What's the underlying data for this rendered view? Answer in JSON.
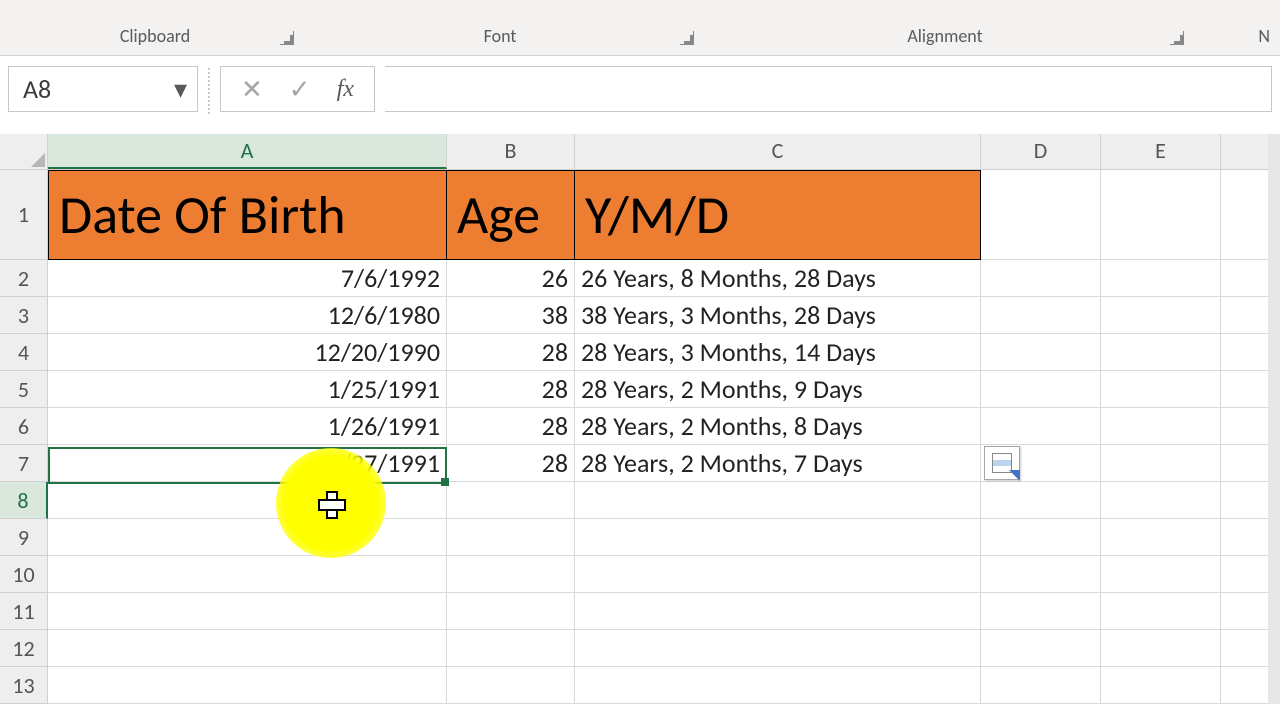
{
  "ribbon": {
    "fmt_painter_hint": "",
    "groups": {
      "clipboard": "Clipboard",
      "font": "Font",
      "alignment": "Alignment",
      "last": "N"
    }
  },
  "namebox": {
    "value": "A8"
  },
  "fx": {
    "label": "fx",
    "cancel_glyph": "✕",
    "accept_glyph": "✓"
  },
  "formula": {
    "value": ""
  },
  "columns": [
    "A",
    "B",
    "C",
    "D",
    "E"
  ],
  "active_column": "A",
  "active_row": 8,
  "rows": [
    "1",
    "2",
    "3",
    "4",
    "5",
    "6",
    "7",
    "8",
    "9",
    "10",
    "11",
    "12",
    "13"
  ],
  "headers": {
    "A": "Date Of Birth",
    "B": "Age",
    "C": "Y/M/D"
  },
  "data": [
    {
      "dob": "7/6/1992",
      "age": "26",
      "ymd": "26 Years, 8 Months, 28 Days"
    },
    {
      "dob": "12/6/1980",
      "age": "38",
      "ymd": "38 Years, 3 Months, 28 Days"
    },
    {
      "dob": "12/20/1990",
      "age": "28",
      "ymd": "28 Years, 3 Months, 14 Days"
    },
    {
      "dob": "1/25/1991",
      "age": "28",
      "ymd": "28 Years, 2 Months, 9 Days"
    },
    {
      "dob": "1/26/1991",
      "age": "28",
      "ymd": "28 Years, 2 Months, 8 Days"
    },
    {
      "dob": "1/27/1991",
      "age": "28",
      "ymd": "28 Years, 2 Months, 7 Days"
    }
  ]
}
